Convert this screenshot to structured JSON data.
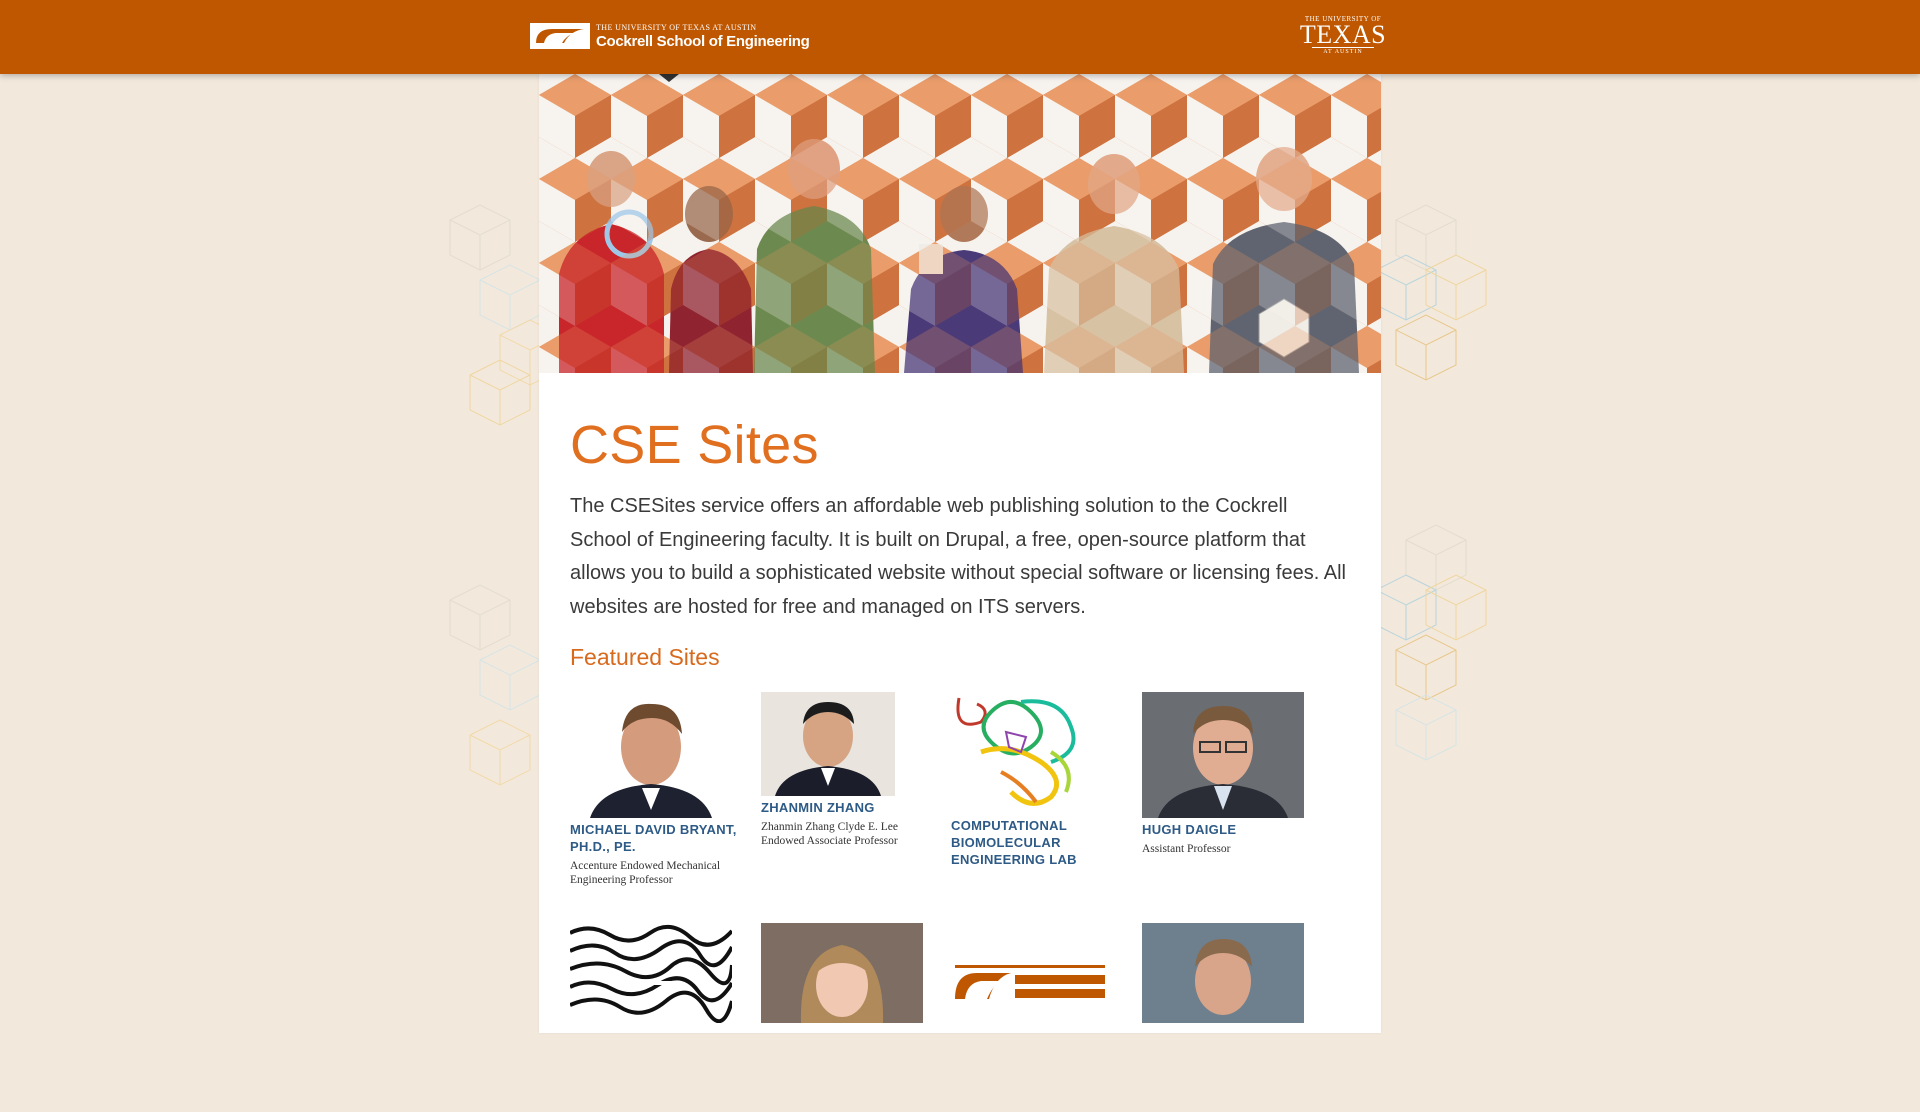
{
  "header": {
    "school_small": "The University of Texas at Austin",
    "school_name": "Cockrell School of Engineering",
    "ut_line1": "The University of",
    "ut_line2": "TEXAS",
    "ut_line3": "at Austin"
  },
  "main": {
    "title": "CSE Sites",
    "intro": "The CSESites service offers an affordable web publishing solution to the Cockrell School of Engineering faculty. It is built on Drupal, a free, open-source platform that allows you to build a sophisticated website without special software or licensing fees. All websites are hosted for free and managed on ITS servers.",
    "featured_heading": "Featured Sites"
  },
  "featured_sites": [
    {
      "name": "Michael David Bryant, Ph.D., PE.",
      "role": "Accenture Endowed Mechanical Engineering Professor",
      "thumb": "portrait-photo"
    },
    {
      "name": "Zhanmin Zhang",
      "role": "Zhanmin Zhang Clyde E. Lee Endowed Associate Professor",
      "thumb": "portrait-photo"
    },
    {
      "name": "Computational Biomolecular Engineering Lab",
      "role": "",
      "thumb": "protein-ribbon-image"
    },
    {
      "name": "Hugh Daigle",
      "role": "Assistant Professor",
      "thumb": "portrait-photo"
    },
    {
      "name": "",
      "role": "",
      "thumb": "bw-texture-image"
    },
    {
      "name": "",
      "role": "",
      "thumb": "portrait-photo"
    },
    {
      "name": "",
      "role": "",
      "thumb": "cockrell-logo-image"
    },
    {
      "name": "",
      "role": "",
      "thumb": "portrait-photo"
    }
  ],
  "colors": {
    "brand_orange": "#bf5700",
    "title_orange": "#e07020",
    "link_blue": "#2e5a86",
    "page_bg": "#f2e8dc"
  }
}
